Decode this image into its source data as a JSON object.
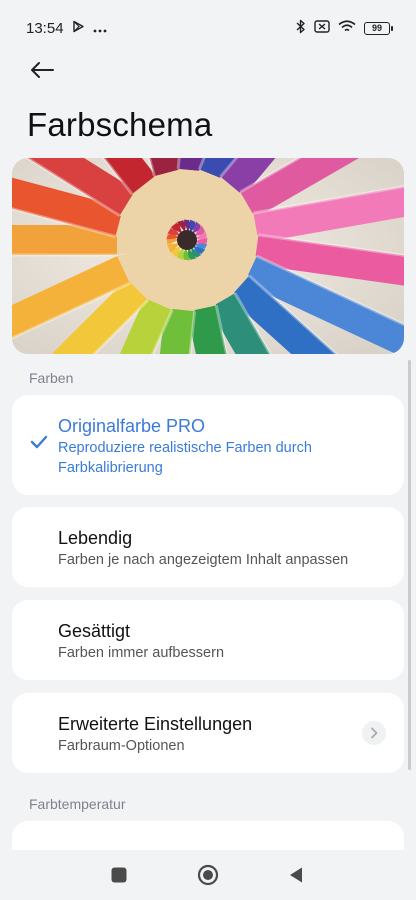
{
  "status_bar": {
    "time": "13:54",
    "battery": "99",
    "icons": [
      "play-store-icon",
      "more-dots-icon",
      "bluetooth-icon",
      "sim-off-icon",
      "wifi-icon",
      "battery-icon"
    ]
  },
  "header": {
    "back_icon": "back-arrow-icon",
    "title": "Farbschema"
  },
  "sections": {
    "colors_label": "Farben",
    "temperature_label": "Farbtemperatur"
  },
  "options": [
    {
      "title": "Originalfarbe PRO",
      "subtitle": "Reproduziere realistische Farben durch Farbkalibrierung",
      "selected": true
    },
    {
      "title": "Lebendig",
      "subtitle": "Farben je nach angezeigtem Inhalt anpassen",
      "selected": false
    },
    {
      "title": "Gesättigt",
      "subtitle": "Farben immer aufbessern",
      "selected": false
    }
  ],
  "advanced": {
    "title": "Erweiterte Einstellungen",
    "subtitle": "Farbraum-Optionen",
    "chevron_icon": "chevron-right-icon"
  },
  "colors": {
    "accent": "#3a7bd9",
    "background": "#f2f3f5",
    "card": "#ffffff"
  },
  "nav": {
    "icons": [
      "recents-square-icon",
      "home-circle-icon",
      "back-triangle-icon"
    ]
  }
}
